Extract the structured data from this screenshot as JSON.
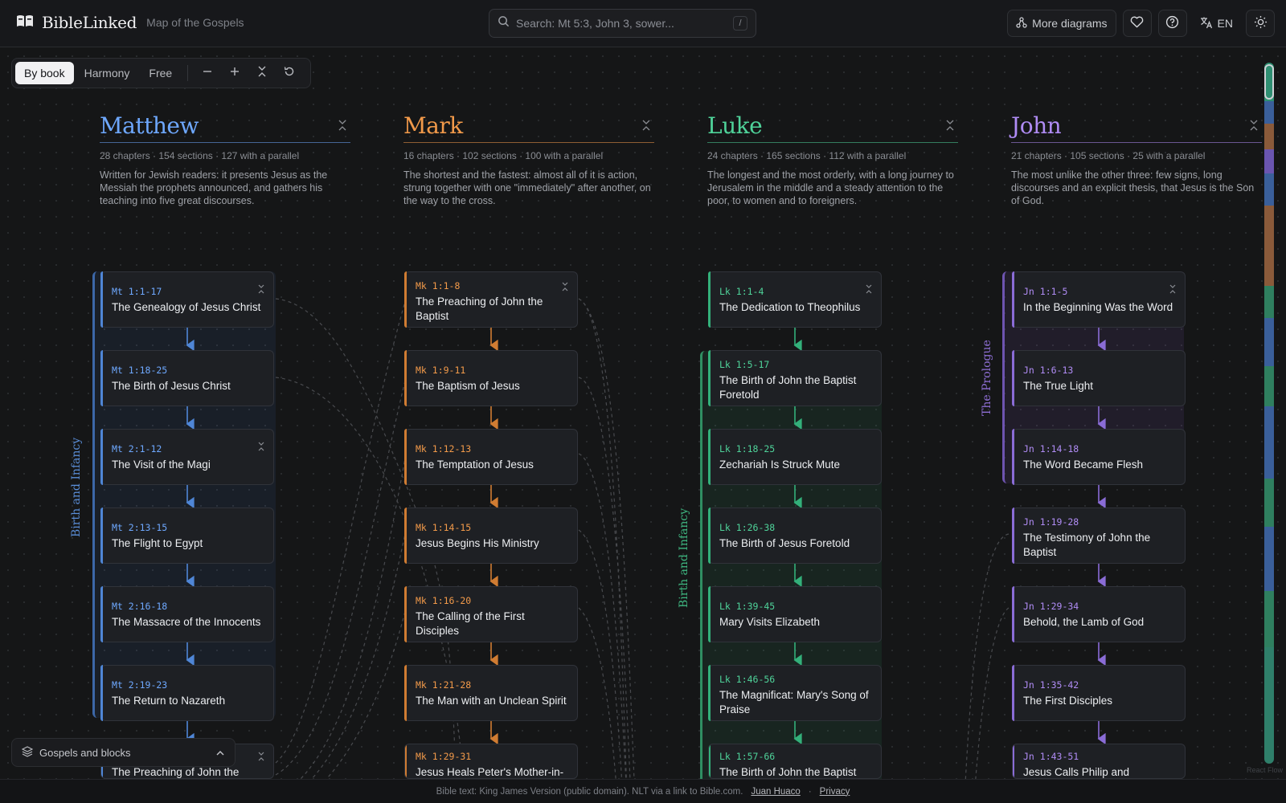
{
  "app": {
    "brand": "BibleLinked",
    "subtitle": "Map of the Gospels"
  },
  "search": {
    "placeholder": "Search: Mt 5:3, John 3, sower...",
    "shortcut": "/"
  },
  "topbar": {
    "more_diagrams": "More diagrams",
    "lang": "EN"
  },
  "toolbar": {
    "modes": [
      "By book",
      "Harmony",
      "Free"
    ],
    "active": "By book"
  },
  "gospels": [
    {
      "name": "Matthew",
      "color": "#6ea8fe",
      "stats": "28 chapters · 154 sections · 127 with a parallel",
      "desc": "Written for Jewish readers: it presents Jesus as the Messiah the prophets announced, and gathers his teaching into five great discourses."
    },
    {
      "name": "Mark",
      "color": "#f29a4a",
      "stats": "16 chapters · 102 sections · 100 with a parallel",
      "desc": "The shortest and the fastest: almost all of it is action, strung together with one \"immediately\" after another, on the way to the cross."
    },
    {
      "name": "Luke",
      "color": "#4fd39a",
      "stats": "24 chapters · 165 sections · 112 with a parallel",
      "desc": "The longest and the most orderly, with a long journey to Jerusalem in the middle and a steady attention to the poor, to women and to foreigners."
    },
    {
      "name": "John",
      "color": "#b08cf5",
      "stats": "21 chapters · 105 sections · 25 with a parallel",
      "desc": "The most unlike the other three: few signs, long discourses and an explicit thesis, that Jesus is the Son of God."
    }
  ],
  "groups": {
    "matthew": "Birth and Infancy",
    "luke": "Birth and Infancy",
    "john": "The Prologue"
  },
  "cards": {
    "matthew": [
      {
        "ref": "Mt 1:1-17",
        "title": "The Genealogy of Jesus Christ"
      },
      {
        "ref": "Mt 1:18-25",
        "title": "The Birth of Jesus Christ"
      },
      {
        "ref": "Mt 2:1-12",
        "title": "The Visit of the Magi"
      },
      {
        "ref": "Mt 2:13-15",
        "title": "The Flight to Egypt"
      },
      {
        "ref": "Mt 2:16-18",
        "title": "The Massacre of the Innocents"
      },
      {
        "ref": "Mt 2:19-23",
        "title": "The Return to Nazareth"
      },
      {
        "ref": "",
        "title": "The Preaching of John the"
      }
    ],
    "mark": [
      {
        "ref": "Mk 1:1-8",
        "title": "The Preaching of John the Baptist"
      },
      {
        "ref": "Mk 1:9-11",
        "title": "The Baptism of Jesus"
      },
      {
        "ref": "Mk 1:12-13",
        "title": "The Temptation of Jesus"
      },
      {
        "ref": "Mk 1:14-15",
        "title": "Jesus Begins His Ministry"
      },
      {
        "ref": "Mk 1:16-20",
        "title": "The Calling of the First Disciples"
      },
      {
        "ref": "Mk 1:21-28",
        "title": "The Man with an Unclean Spirit"
      },
      {
        "ref": "Mk 1:29-31",
        "title": "Jesus Heals Peter's Mother-in-"
      }
    ],
    "luke": [
      {
        "ref": "Lk 1:1-4",
        "title": "The Dedication to Theophilus"
      },
      {
        "ref": "Lk 1:5-17",
        "title": "The Birth of John the Baptist Foretold"
      },
      {
        "ref": "Lk 1:18-25",
        "title": "Zechariah Is Struck Mute"
      },
      {
        "ref": "Lk 1:26-38",
        "title": "The Birth of Jesus Foretold"
      },
      {
        "ref": "Lk 1:39-45",
        "title": "Mary Visits Elizabeth"
      },
      {
        "ref": "Lk 1:46-56",
        "title": "The Magnificat: Mary's Song of Praise"
      },
      {
        "ref": "Lk 1:57-66",
        "title": "The Birth of John the Baptist"
      }
    ],
    "john": [
      {
        "ref": "Jn 1:1-5",
        "title": "In the Beginning Was the Word"
      },
      {
        "ref": "Jn 1:6-13",
        "title": "The True Light"
      },
      {
        "ref": "Jn 1:14-18",
        "title": "The Word Became Flesh"
      },
      {
        "ref": "Jn 1:19-28",
        "title": "The Testimony of John the Baptist"
      },
      {
        "ref": "Jn 1:29-34",
        "title": "Behold, the Lamb of God"
      },
      {
        "ref": "Jn 1:35-42",
        "title": "The First Disciples"
      },
      {
        "ref": "Jn 1:43-51",
        "title": "Jesus Calls Philip and"
      }
    ]
  },
  "layers": {
    "label": "Gospels and blocks"
  },
  "footer": {
    "text": "Bible text: King James Version (public domain). NLT via a link to Bible.com.",
    "author": "Juan Huaco",
    "privacy": "Privacy"
  },
  "attribution": "React Flow"
}
